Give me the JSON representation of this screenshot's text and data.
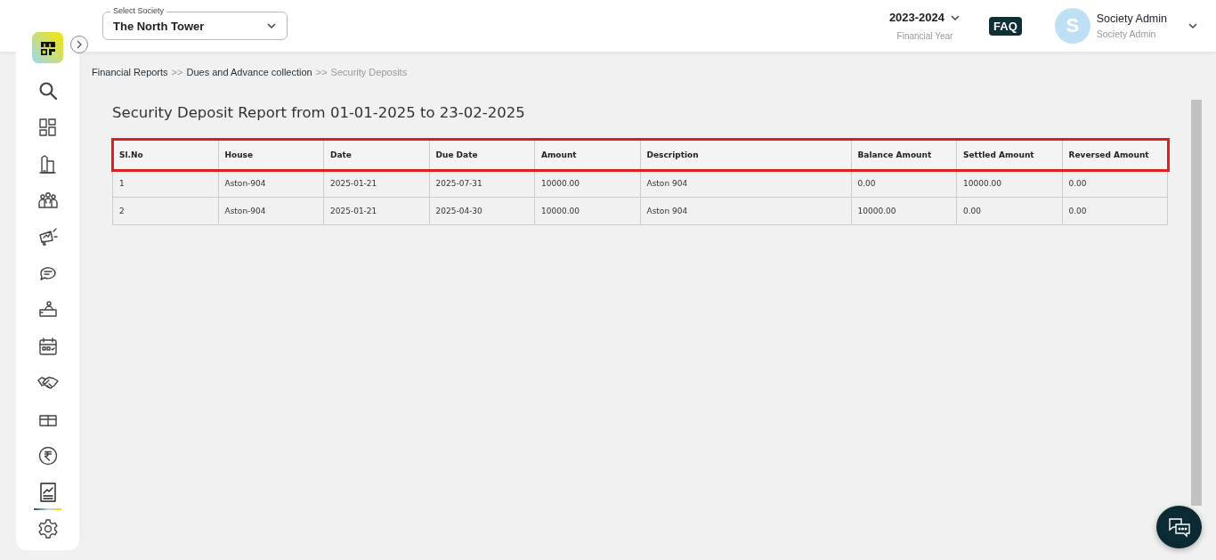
{
  "header": {
    "society_select": {
      "label": "Select Society",
      "value": "The North Tower"
    },
    "financial_year": {
      "value": "2023-2024",
      "label": "Financial Year"
    },
    "faq": "FAQ",
    "user": {
      "initial": "S",
      "name": "Society Admin",
      "role": "Society Admin"
    }
  },
  "sidebar": {
    "items": [
      {
        "selected": false
      },
      {
        "selected": false
      },
      {
        "selected": false
      },
      {
        "selected": false
      },
      {
        "selected": false
      },
      {
        "selected": false
      },
      {
        "selected": false
      },
      {
        "selected": false
      },
      {
        "selected": false
      },
      {
        "selected": false
      },
      {
        "selected": false
      },
      {
        "selected": true
      },
      {
        "selected": false
      }
    ]
  },
  "breadcrumb": [
    {
      "label": "Financial Reports",
      "current": false
    },
    {
      "label": "Dues and Advance collection",
      "current": false
    },
    {
      "label": "Security Deposits",
      "current": true
    }
  ],
  "breadcrumb_separator": ">>",
  "report": {
    "title": "Security Deposit Report from 01-01-2025 to 23-02-2025",
    "table": {
      "header_highlighted": true,
      "columns": [
        "Sl.No",
        "House",
        "Date",
        "Due Date",
        "Amount",
        "Description",
        "Balance Amount",
        "Settled Amount",
        "Reversed Amount"
      ],
      "rows": [
        [
          "1",
          "Aston-904",
          "2025-01-21",
          "2025-07-31",
          "10000.00",
          "Aston 904",
          "0.00",
          "10000.00",
          "0.00"
        ],
        [
          "2",
          "Aston-904",
          "2025-01-21",
          "2025-04-30",
          "10000.00",
          "Aston 904",
          "10000.00",
          "0.00",
          "0.00"
        ]
      ]
    }
  }
}
